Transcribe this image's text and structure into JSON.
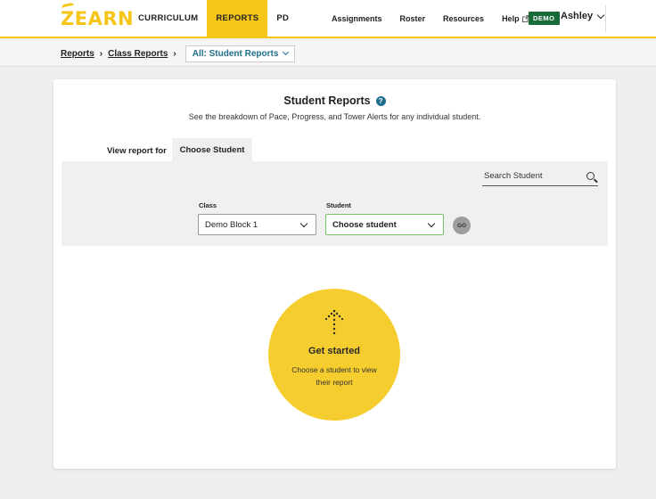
{
  "header": {
    "logo": "ZEARN",
    "nav_main": [
      "CURRICULUM",
      "REPORTS",
      "PD"
    ],
    "nav_secondary": [
      "Assignments",
      "Roster",
      "Resources",
      "Help"
    ],
    "demo_badge": "DEMO",
    "user_name": "Ashley"
  },
  "breadcrumb": {
    "reports": "Reports",
    "class_reports": "Class Reports",
    "current": "All: Student Reports"
  },
  "page": {
    "title": "Student Reports",
    "help_glyph": "?",
    "subtitle": "See the breakdown of Pace, Progress, and Tower Alerts for any individual student.",
    "view_report_for": "View report for",
    "tab_label": "Choose Student"
  },
  "filters": {
    "search_placeholder": "Search Student",
    "class_label": "Class",
    "class_value": "Demo Block 1",
    "student_label": "Student",
    "student_value": "Choose student",
    "go_label": "GO"
  },
  "empty_state": {
    "title": "Get started",
    "text": "Choose a student to view their report"
  },
  "colors": {
    "accent": "#f5c518",
    "demo_green": "#1b6b3a",
    "link_teal": "#1d6f8c",
    "select_border": "#7cc46a"
  },
  "icons": [
    "external-link-icon",
    "chevron-down-icon",
    "help-icon",
    "search-icon",
    "dotted-arrow-up-icon"
  ]
}
